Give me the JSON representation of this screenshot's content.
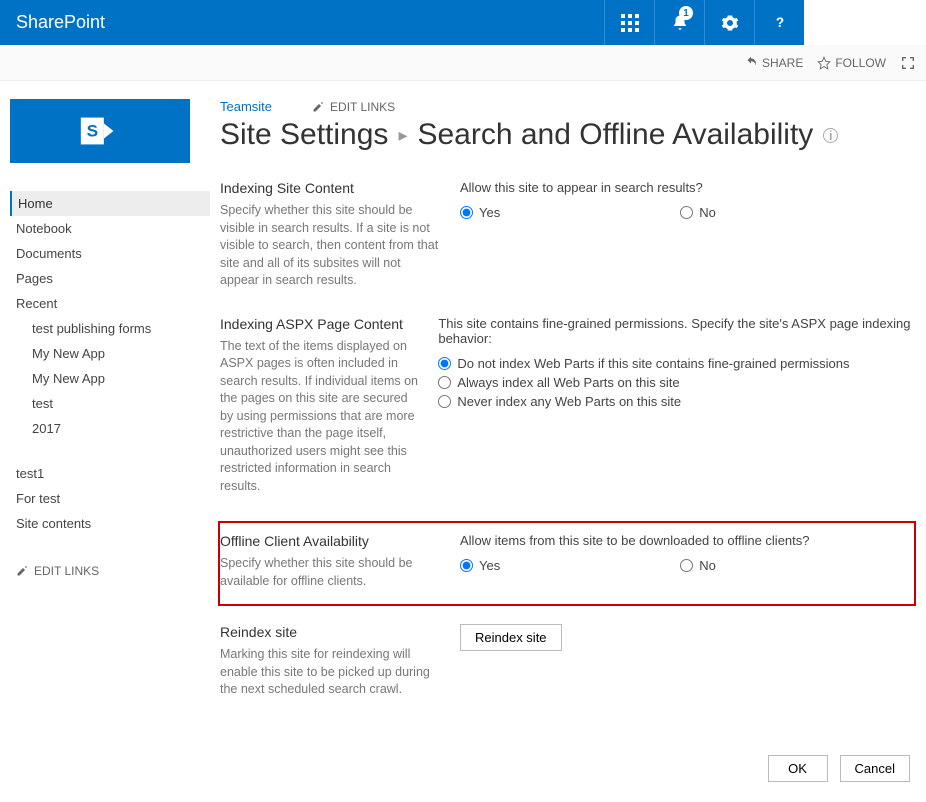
{
  "brand": "SharePoint",
  "notification_count": "1",
  "actions": {
    "share": "SHARE",
    "follow": "FOLLOW"
  },
  "breadcrumb": {
    "site": "Teamsite",
    "edit_links": "EDIT LINKS"
  },
  "title": {
    "parent": "Site Settings",
    "page": "Search and Offline Availability"
  },
  "nav": {
    "items": [
      "Home",
      "Notebook",
      "Documents",
      "Pages",
      "Recent"
    ],
    "recent": [
      "test publishing forms",
      "My New App",
      "My New App",
      "test",
      "2017"
    ],
    "after": [
      "test1",
      "For test",
      "Site contents"
    ],
    "edit_links": "EDIT LINKS"
  },
  "sections": {
    "index_site": {
      "heading": "Indexing Site Content",
      "desc": "Specify whether this site should be visible in search results. If a site is not visible to search, then content from that site and all of its subsites will not appear in search results.",
      "question": "Allow this site to appear in search results?",
      "yes": "Yes",
      "no": "No"
    },
    "index_aspx": {
      "heading": "Indexing ASPX Page Content",
      "desc": "The text of the items displayed on ASPX pages is often included in search results. If individual items on the pages on this site are secured by using permissions that are more restrictive than the page itself, unauthorized users might see this restricted information in search results.",
      "question": "This site contains fine-grained permissions. Specify the site's ASPX page indexing behavior:",
      "opt1": "Do not index Web Parts if this site contains fine-grained permissions",
      "opt2": "Always index all Web Parts on this site",
      "opt3": "Never index any Web Parts on this site"
    },
    "offline": {
      "heading": "Offline Client Availability",
      "desc": "Specify whether this site should be available for offline clients.",
      "question": "Allow items from this site to be downloaded to offline clients?",
      "yes": "Yes",
      "no": "No"
    },
    "reindex": {
      "heading": "Reindex site",
      "desc": "Marking this site for reindexing will enable this site to be picked up during the next scheduled search crawl.",
      "button": "Reindex site"
    }
  },
  "buttons": {
    "ok": "OK",
    "cancel": "Cancel"
  }
}
